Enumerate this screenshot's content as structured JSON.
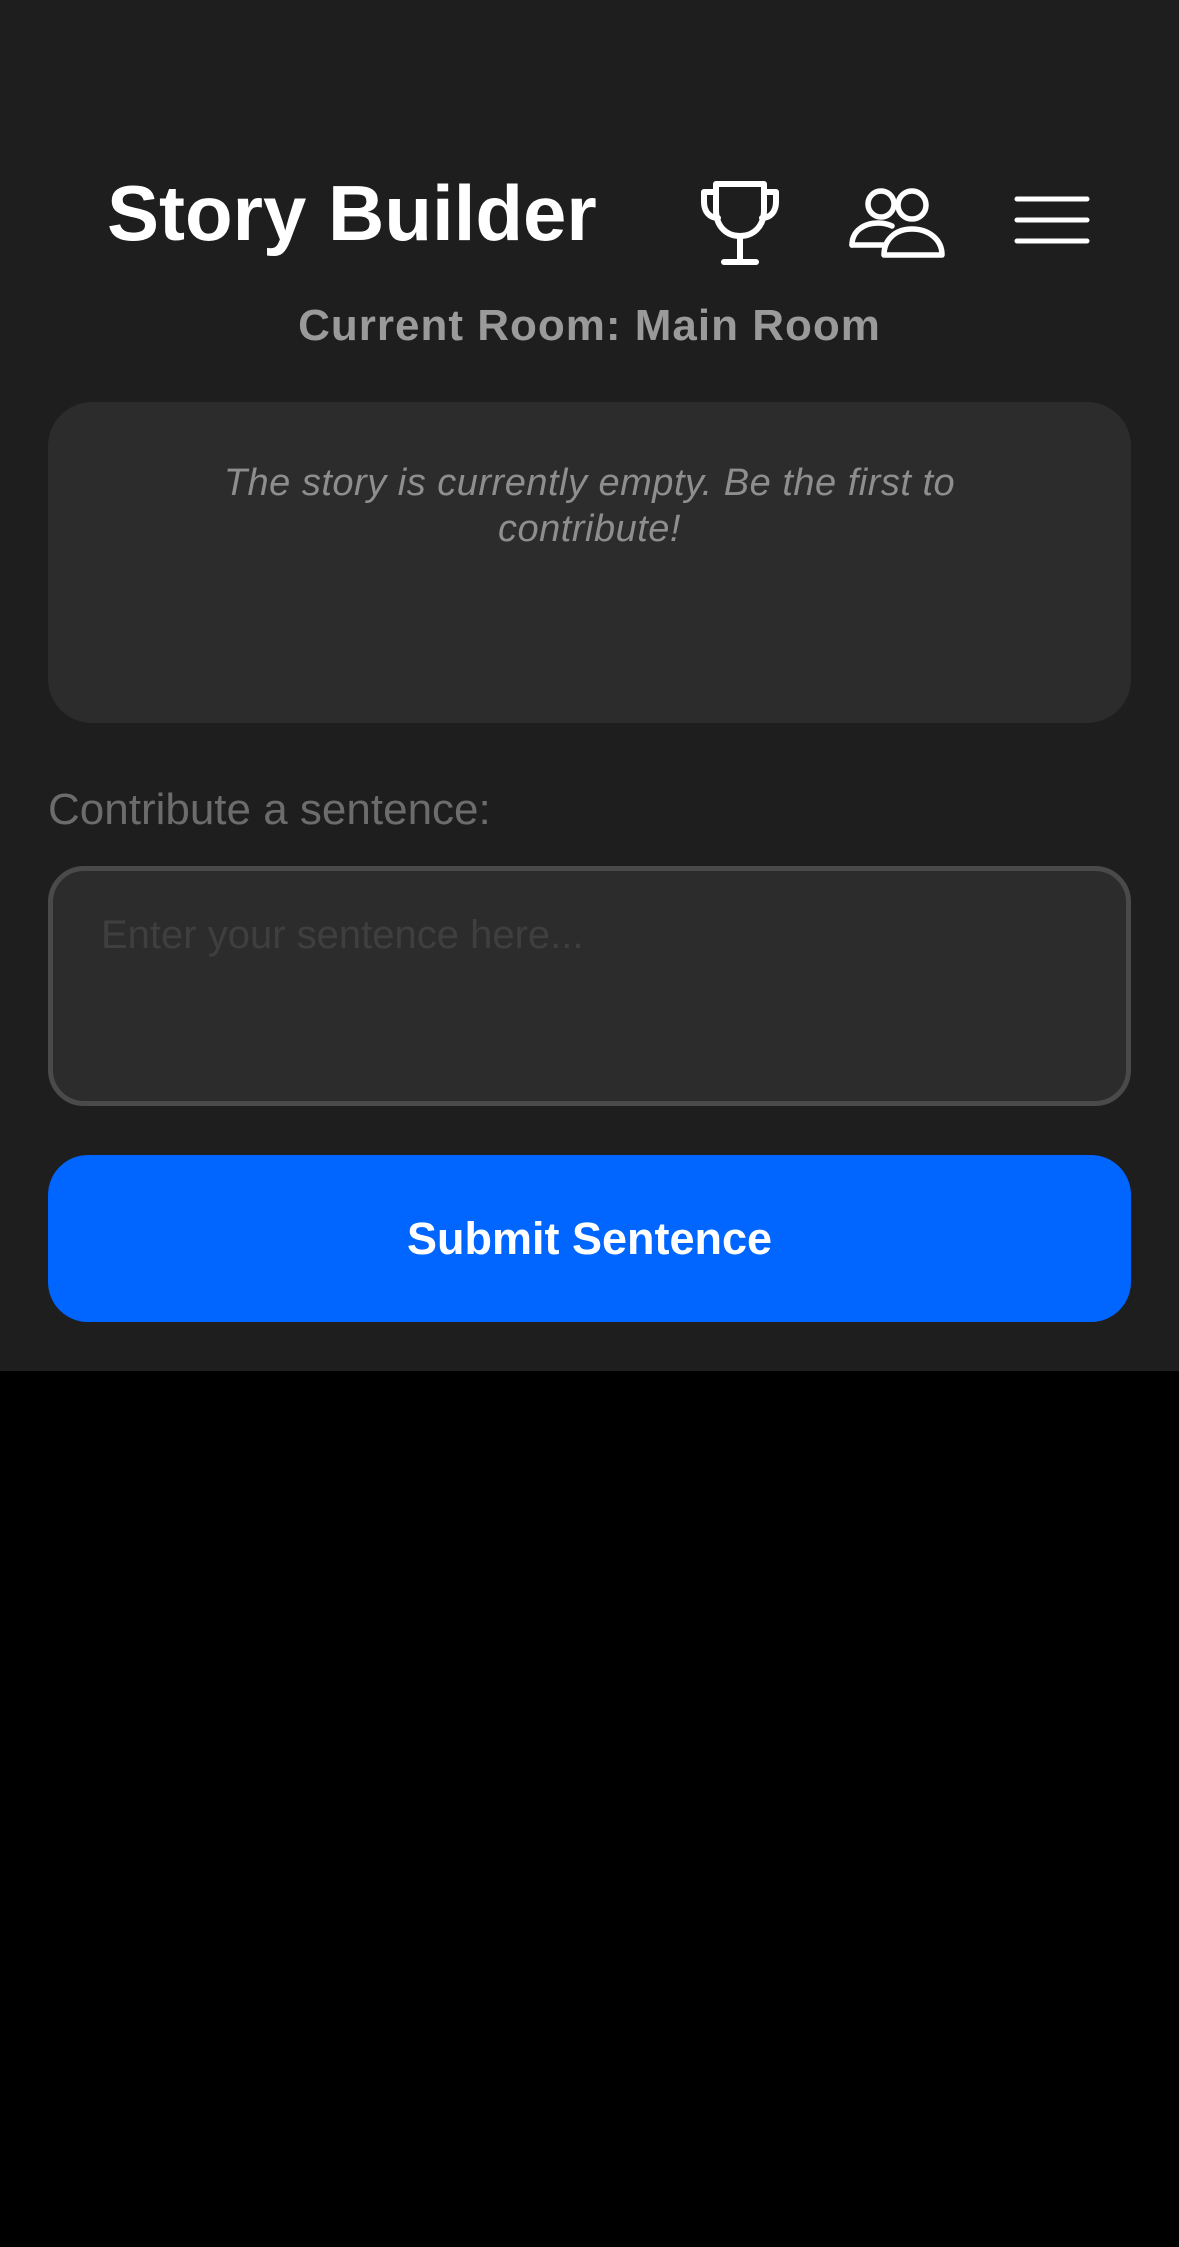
{
  "header": {
    "title": "Story Builder",
    "icons": [
      "trophy-icon",
      "users-icon",
      "hamburger-menu-icon"
    ]
  },
  "room": {
    "label": "Current Room: Main Room"
  },
  "story": {
    "empty_message": "The story is currently empty. Be the first to contribute!"
  },
  "contribute": {
    "label": "Contribute a sentence:",
    "placeholder": "Enter your sentence here...",
    "value": ""
  },
  "submit": {
    "label": "Submit Sentence"
  },
  "colors": {
    "app_background": "#1e1e1e",
    "outer_background": "#000000",
    "card_background": "#2c2c2c",
    "accent": "#0066ff",
    "title_text": "#ffffff",
    "muted_text": "#9a9a9a"
  }
}
